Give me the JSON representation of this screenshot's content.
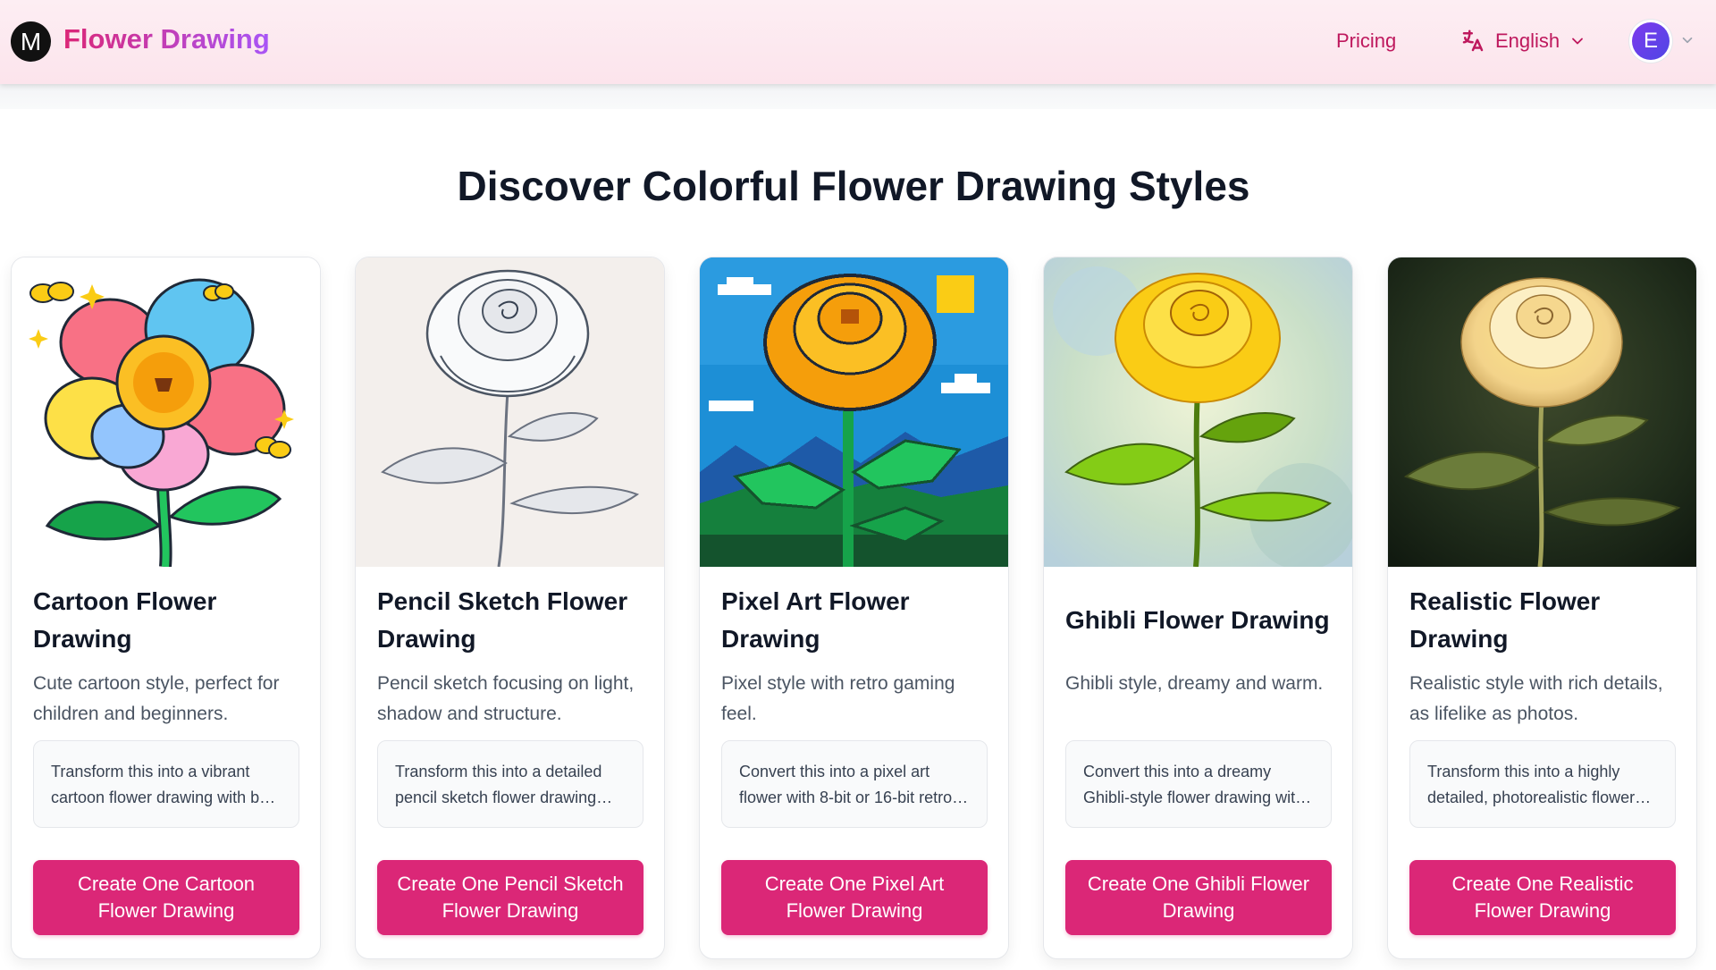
{
  "header": {
    "logo_letter": "M",
    "brand": "Flower Drawing",
    "nav_pricing": "Pricing",
    "language": "English",
    "avatar_letter": "E"
  },
  "section": {
    "title": "Discover Colorful Flower Drawing Styles"
  },
  "cards": [
    {
      "image": "cartoon-flower-image",
      "title": "Cartoon Flower Drawing",
      "description": "Cute cartoon style, perfect for children and beginners.",
      "prompt": "Transform this into a vibrant cartoon flower drawing with bold outlines and bright colors",
      "button": "Create One Cartoon Flower Drawing"
    },
    {
      "image": "pencil-sketch-rose-image",
      "title": "Pencil Sketch Flower Drawing",
      "description": "Pencil sketch focusing on light, shadow and structure.",
      "prompt": "Transform this into a detailed pencil sketch flower drawing with soft shading",
      "button": "Create One Pencil Sketch Flower Drawing"
    },
    {
      "image": "pixel-art-rose-image",
      "title": "Pixel Art Flower Drawing",
      "description": "Pixel style with retro gaming feel.",
      "prompt": "Convert this into a pixel art flower with 8-bit or 16-bit retro colors",
      "button": "Create One Pixel Art Flower Drawing"
    },
    {
      "image": "ghibli-rose-image",
      "title": "Ghibli Flower Drawing",
      "description": "Ghibli style, dreamy and warm.",
      "prompt": "Convert this into a dreamy Ghibli-style flower drawing with soft watercolor tones",
      "button": "Create One Ghibli Flower Drawing"
    },
    {
      "image": "realistic-rose-image",
      "title": "Realistic Flower Drawing",
      "description": "Realistic style with rich details, as lifelike as photos.",
      "prompt": "Transform this into a highly detailed, photorealistic flower drawing with natural lighting",
      "button": "Create One Realistic Flower Drawing"
    }
  ],
  "icons": {
    "translate": "translate-icon",
    "language_chevron": "chevron-down-icon",
    "avatar_chevron": "chevron-down-icon"
  },
  "colors": {
    "accent": "#db2777",
    "nav_text": "#be185d",
    "header_bg": "#fde8ef"
  }
}
